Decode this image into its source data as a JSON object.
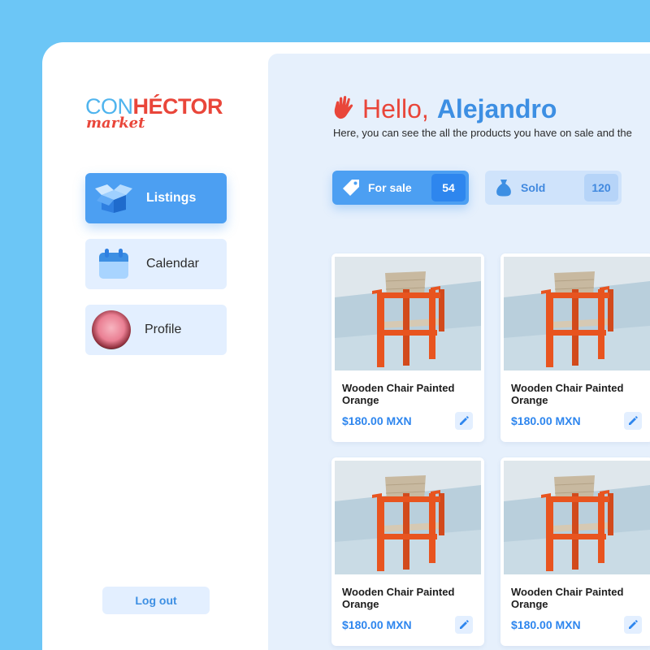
{
  "brand": {
    "part1": "CON",
    "part2": "HÉCTOR",
    "part3": "market"
  },
  "sidebar": {
    "items": [
      {
        "label": "Listings",
        "icon": "box-icon",
        "active": true
      },
      {
        "label": "Calendar",
        "icon": "calendar-icon",
        "active": false
      },
      {
        "label": "Profile",
        "icon": "avatar",
        "active": false
      }
    ],
    "logout_label": "Log out"
  },
  "header": {
    "hello": "Hello,",
    "name": "Alejandro",
    "subtitle": "Here, you can see the all the products you have on sale and the"
  },
  "stats": {
    "for_sale": {
      "label": "For sale",
      "count": "54",
      "icon": "tag-icon"
    },
    "sold": {
      "label": "Sold",
      "count": "120",
      "icon": "money-bag-icon"
    }
  },
  "products": [
    {
      "title": "Wooden Chair Painted Orange",
      "price": "$180.00 MXN"
    },
    {
      "title": "Wooden Chair Painted Orange",
      "price": "$180.00 MXN"
    },
    {
      "title": "Wooden Chair Painted Orange",
      "price": "$180.00 MXN"
    },
    {
      "title": "Wooden Chair Painted Orange",
      "price": "$180.00 MXN"
    }
  ],
  "colors": {
    "background": "#6cc6f6",
    "accent_blue": "#4c9ff2",
    "brand_red": "#e9463a",
    "panel": "#e6f0fc"
  }
}
